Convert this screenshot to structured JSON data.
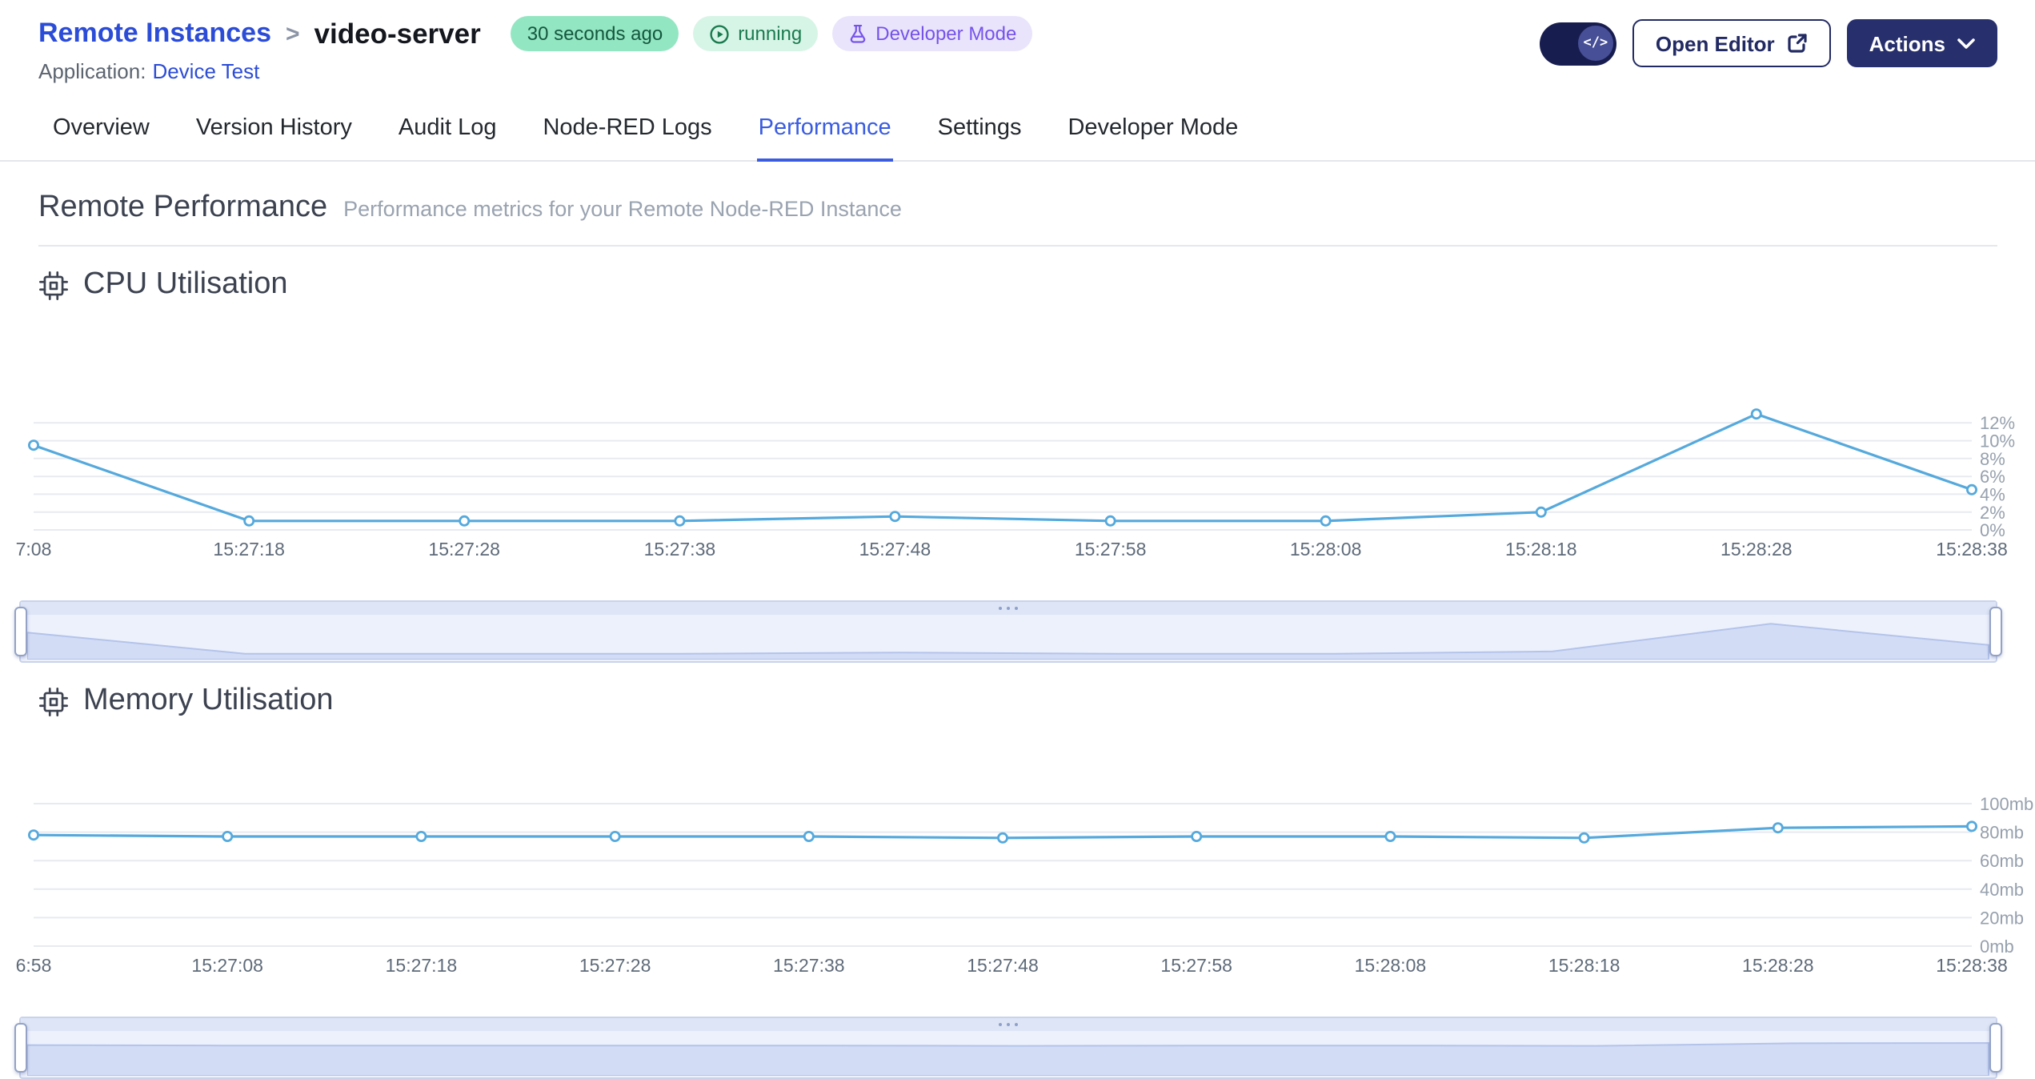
{
  "header": {
    "breadcrumb": {
      "root": "Remote Instances",
      "separator": ">",
      "current": "video-server"
    },
    "badges": {
      "last_updated": "30 seconds ago",
      "status": "running",
      "developer_mode": "Developer Mode"
    },
    "application": {
      "label": "Application:",
      "name": "Device Test"
    },
    "actions": {
      "code_toggle": "</>",
      "open_editor": "Open Editor",
      "actions": "Actions"
    }
  },
  "icons": {
    "status": "play-circle",
    "developer_mode": "flask",
    "toggle_knob": "code",
    "open_editor": "external-link",
    "actions": "chevron-down",
    "sections": "cpu-chip",
    "datazoom_grip": "drag-dots"
  },
  "tabs": {
    "items": [
      {
        "label": "Overview",
        "active": false
      },
      {
        "label": "Version History",
        "active": false
      },
      {
        "label": "Audit Log",
        "active": false
      },
      {
        "label": "Node-RED Logs",
        "active": false
      },
      {
        "label": "Performance",
        "active": true
      },
      {
        "label": "Settings",
        "active": false
      },
      {
        "label": "Developer Mode",
        "active": false
      }
    ]
  },
  "content": {
    "title": "Remote Performance",
    "subtitle": "Performance metrics for your Remote Node-RED Instance"
  },
  "colors": {
    "link_blue": "#2b4cd7",
    "active_tab": "#3a5ce0",
    "navy_button": "#272f6d",
    "chart_line": "#55a9dc",
    "badge_green_solid": "#93e6c2",
    "badge_green_soft": "#d7f5e6",
    "badge_purple": "#e9e4fb"
  },
  "chart_data": [
    {
      "type": "line",
      "title": "CPU Utilisation",
      "x": [
        "7:08",
        "15:27:18",
        "15:27:28",
        "15:27:38",
        "15:27:48",
        "15:27:58",
        "15:28:08",
        "15:28:18",
        "15:28:28",
        "15:28:38"
      ],
      "values": [
        9.5,
        1,
        1,
        1,
        1.5,
        1,
        1,
        2,
        13,
        4.5
      ],
      "yticks": [
        {
          "v": 0,
          "label": "0%"
        },
        {
          "v": 2,
          "label": "2%"
        },
        {
          "v": 4,
          "label": "4%"
        },
        {
          "v": 6,
          "label": "6%"
        },
        {
          "v": 8,
          "label": "8%"
        },
        {
          "v": 10,
          "label": "10%"
        },
        {
          "v": 12,
          "label": "12%"
        }
      ],
      "ylim": [
        0,
        14
      ],
      "xlabel": "",
      "ylabel": "",
      "grid": true,
      "legend_position": "none",
      "line_color": "#55a9dc",
      "datazoom": {
        "range_start": "15:27:08",
        "range_end": "15:28:38",
        "selected": "100%"
      }
    },
    {
      "type": "line",
      "title": "Memory Utilisation",
      "x": [
        "6:58",
        "15:27:08",
        "15:27:18",
        "15:27:28",
        "15:27:38",
        "15:27:48",
        "15:27:58",
        "15:28:08",
        "15:28:18",
        "15:28:28",
        "15:28:38"
      ],
      "values": [
        78,
        77,
        77,
        77,
        77,
        76,
        77,
        77,
        76,
        83,
        84
      ],
      "yticks": [
        {
          "v": 0,
          "label": "0mb"
        },
        {
          "v": 20,
          "label": "20mb"
        },
        {
          "v": 40,
          "label": "40mb"
        },
        {
          "v": 60,
          "label": "60mb"
        },
        {
          "v": 80,
          "label": "80mb"
        },
        {
          "v": 100,
          "label": "100mb"
        }
      ],
      "ylim": [
        0,
        100
      ],
      "xlabel": "",
      "ylabel": "",
      "grid": true,
      "legend_position": "none",
      "line_color": "#55a9dc",
      "datazoom": {
        "range_start": "15:26:58",
        "range_end": "15:28:38",
        "selected": "100%"
      }
    }
  ]
}
